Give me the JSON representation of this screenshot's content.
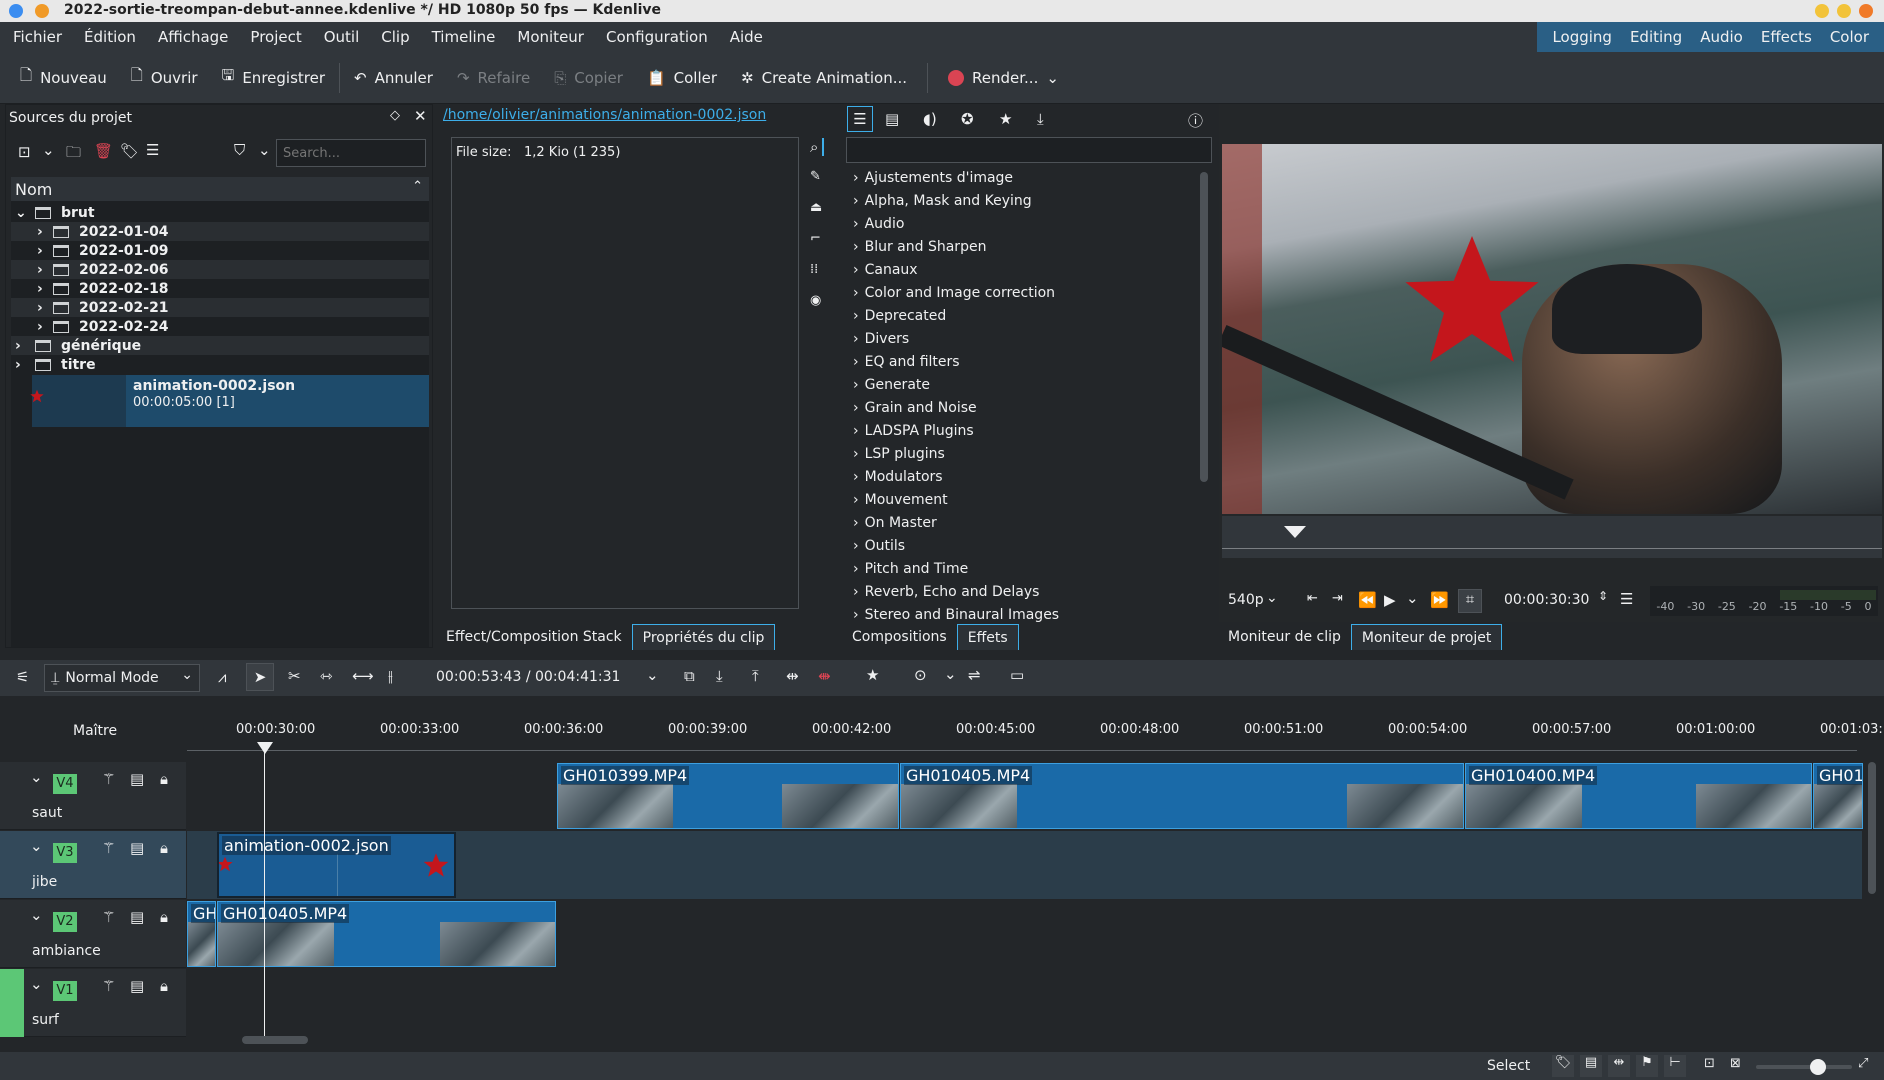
{
  "window": {
    "title": "2022-sortie-treompan-debut-annee.kdenlive */ HD 1080p 50 fps — Kdenlive"
  },
  "menu": [
    "Fichier",
    "Édition",
    "Affichage",
    "Project",
    "Outil",
    "Clip",
    "Timeline",
    "Moniteur",
    "Configuration",
    "Aide"
  ],
  "workspaces": [
    "Logging",
    "Editing",
    "Audio",
    "Effects",
    "Color"
  ],
  "toolbar": {
    "nouveau": "Nouveau",
    "ouvrir": "Ouvrir",
    "enregistrer": "Enregistrer",
    "annuler": "Annuler",
    "refaire": "Refaire",
    "copier": "Copier",
    "coller": "Coller",
    "create_animation": "Create Animation...",
    "render": "Render..."
  },
  "project_bin": {
    "title": "Sources du projet",
    "search_placeholder": "Search...",
    "column": "Nom",
    "tree": {
      "brut": "brut",
      "dates": [
        "2022-01-04",
        "2022-01-09",
        "2022-02-06",
        "2022-02-18",
        "2022-02-21",
        "2022-02-24"
      ],
      "generique": "générique",
      "titre": "titre",
      "clip_name": "animation-0002.json",
      "clip_info": "00:00:05:00 [1]"
    }
  },
  "clip_props": {
    "path": "/home/olivier/animations/animation-0002.json",
    "file_size_label": "File size:",
    "file_size_value": "1,2 Kio (1 235)"
  },
  "effects": {
    "categories": [
      "Ajustements d'image",
      "Alpha, Mask and Keying",
      "Audio",
      "Blur and Sharpen",
      "Canaux",
      "Color and Image correction",
      "Deprecated",
      "Divers",
      "EQ and filters",
      "Generate",
      "Grain and Noise",
      "LADSPA Plugins",
      "LSP plugins",
      "Modulators",
      "Mouvement",
      "On Master",
      "Outils",
      "Pitch and Time",
      "Reverb, Echo and Delays",
      "Stereo and Binaural Images"
    ]
  },
  "tabs_left": {
    "stack": "Effect/Composition Stack",
    "props": "Propriétés du clip"
  },
  "tabs_mid": {
    "compositions": "Compositions",
    "effets": "Effets"
  },
  "tabs_right": {
    "clip_monitor": "Moniteur de clip",
    "project_monitor": "Moniteur de projet"
  },
  "monitor": {
    "resolution": "540p",
    "timecode": "00:00:30:30",
    "db_scale": [
      "-40",
      "-30",
      "-25",
      "-20",
      "-15",
      "-10",
      "-5",
      "0"
    ]
  },
  "timeline_toolbar": {
    "mode": "Normal Mode",
    "position": "00:00:53:43 / 00:04:41:31"
  },
  "timeline": {
    "master_label": "Maître",
    "ruler": [
      "00:00:30:00",
      "00:00:33:00",
      "00:00:36:00",
      "00:00:39:00",
      "00:00:42:00",
      "00:00:45:00",
      "00:00:48:00",
      "00:00:51:00",
      "00:00:54:00",
      "00:00:57:00",
      "00:01:00:00",
      "00:01:03:"
    ],
    "tracks": [
      {
        "badge": "V4",
        "name": "saut"
      },
      {
        "badge": "V3",
        "name": "jibe"
      },
      {
        "badge": "V2",
        "name": "ambiance"
      },
      {
        "badge": "V1",
        "name": "surf"
      }
    ],
    "clips": {
      "v4a": "GH010399.MP4",
      "v4b": "GH010405.MP4",
      "v4c": "GH010400.MP4",
      "v4d": "GH01",
      "v3a": "animation-0002.json",
      "v2a": "GH",
      "v2b": "GH010405.MP4"
    }
  },
  "statusbar": {
    "select": "Select"
  },
  "colors": {
    "accent": "#3daee9",
    "clip": "#1a6aa8",
    "track_badge": "#5cc776",
    "star": "#c4161c"
  }
}
